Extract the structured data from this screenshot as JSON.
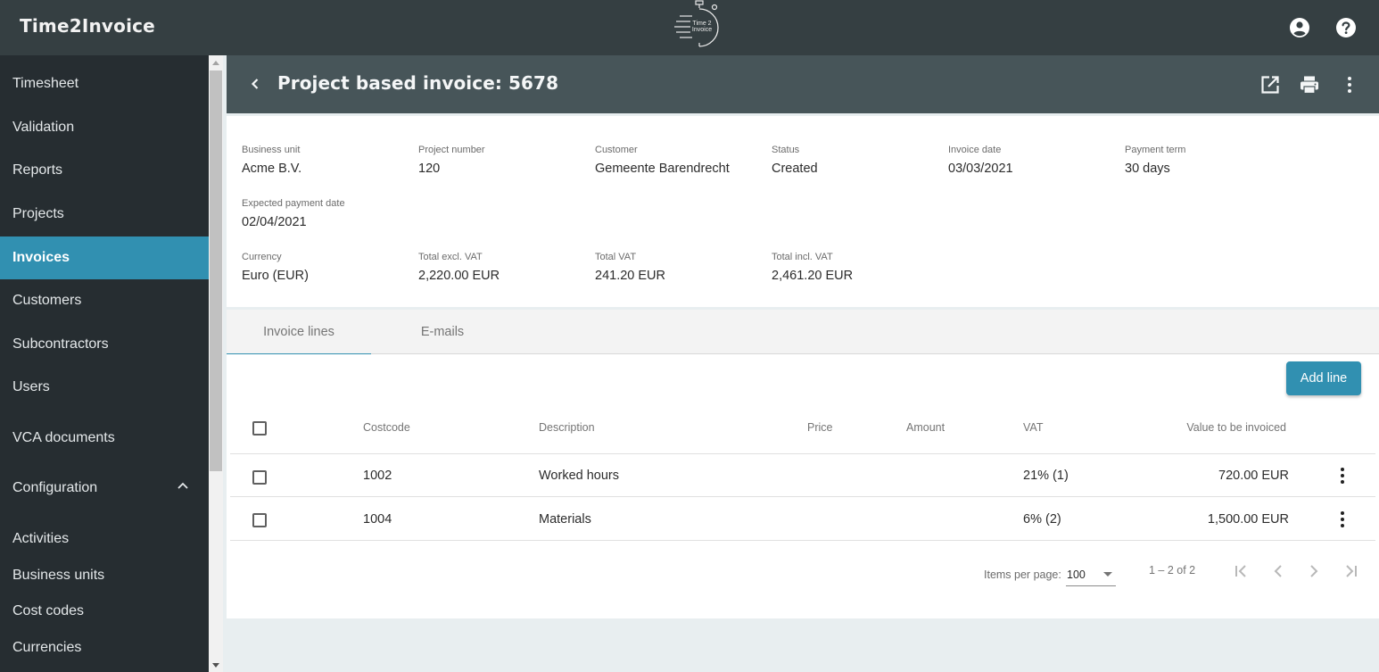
{
  "app": {
    "brand": "Time2Invoice",
    "logo_text_line1": "Time 2",
    "logo_text_line2": "Invoice",
    "icons": {
      "account": "account-circle-icon",
      "help": "help-icon"
    }
  },
  "sidebar": {
    "items": [
      {
        "label": "Timesheet",
        "active": false
      },
      {
        "label": "Validation",
        "active": false
      },
      {
        "label": "Reports",
        "active": false
      },
      {
        "label": "Projects",
        "active": false
      },
      {
        "label": "Invoices",
        "active": true
      },
      {
        "label": "Customers",
        "active": false
      },
      {
        "label": "Subcontractors",
        "active": false
      },
      {
        "label": "Users",
        "active": false
      },
      {
        "label": "VCA documents",
        "active": false
      },
      {
        "label": "Configuration",
        "active": false,
        "expanded": true
      }
    ],
    "sub_items": [
      {
        "label": "Activities"
      },
      {
        "label": "Business units"
      },
      {
        "label": "Cost codes"
      },
      {
        "label": "Currencies"
      }
    ]
  },
  "header": {
    "title": "Project based invoice: 5678",
    "actions": [
      "open-in-new-icon",
      "print-icon",
      "more-vert-icon"
    ]
  },
  "details": {
    "business_unit": {
      "label": "Business unit",
      "value": "Acme B.V."
    },
    "project_number": {
      "label": "Project number",
      "value": "120"
    },
    "customer": {
      "label": "Customer",
      "value": "Gemeente Barendrecht"
    },
    "status": {
      "label": "Status",
      "value": "Created"
    },
    "invoice_date": {
      "label": "Invoice date",
      "value": "03/03/2021"
    },
    "payment_term": {
      "label": "Payment term",
      "value": "30 days"
    },
    "expected_payment_date": {
      "label": "Expected payment date",
      "value": "02/04/2021"
    },
    "currency": {
      "label": "Currency",
      "value": "Euro (EUR)"
    },
    "total_excl_vat": {
      "label": "Total excl. VAT",
      "value": "2,220.00 EUR"
    },
    "total_vat": {
      "label": "Total VAT",
      "value": "241.20 EUR"
    },
    "total_incl_vat": {
      "label": "Total incl. VAT",
      "value": "2,461.20 EUR"
    }
  },
  "tabs": [
    {
      "label": "Invoice lines",
      "active": true
    },
    {
      "label": "E-mails",
      "active": false
    }
  ],
  "lines": {
    "add_label": "Add line",
    "columns": {
      "costcode": "Costcode",
      "description": "Description",
      "price": "Price",
      "amount": "Amount",
      "vat": "VAT",
      "value": "Value to be invoiced"
    },
    "rows": [
      {
        "costcode": "1002",
        "description": "Worked hours",
        "price": "",
        "amount": "",
        "vat": "21% (1)",
        "value": "720.00 EUR",
        "checked": false
      },
      {
        "costcode": "1004",
        "description": "Materials",
        "price": "",
        "amount": "",
        "vat": "6% (2)",
        "value": "1,500.00 EUR",
        "checked": false
      }
    ],
    "paginator": {
      "items_per_page_label": "Items per page:",
      "items_per_page": "100",
      "range": "1 – 2 of 2"
    }
  },
  "colors": {
    "topbar": "#353f42",
    "sidebar": "#262d31",
    "accent": "#3190b1",
    "header": "#475559",
    "page_bg": "#e8eef0"
  }
}
